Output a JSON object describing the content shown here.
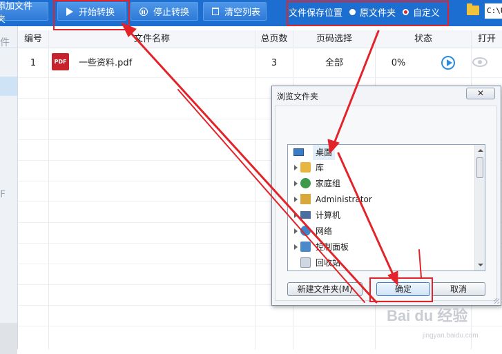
{
  "toolbar": {
    "add_files_label": "添加文件夹",
    "start_label": "开始转换",
    "stop_label": "停止转换",
    "clear_label": "清空列表",
    "save_location_label": "文件保存位置",
    "option_original": "原文件夹",
    "option_custom": "自定义",
    "selected_option": "custom",
    "path_value": "C:\\U"
  },
  "left_strip": {
    "label_a": "件",
    "label_b": "F"
  },
  "table": {
    "headers": [
      "编号",
      "文件名称",
      "总页数",
      "页码选择",
      "状态",
      "打开"
    ],
    "rows": [
      {
        "index": "1",
        "filename": "一些资料.pdf",
        "pages": "3",
        "page_select": "全部",
        "status": "0%",
        "file_icon": "PDF"
      }
    ]
  },
  "dialog": {
    "title": "浏览文件夹",
    "close_label": "✕",
    "tree": [
      {
        "label": "桌面",
        "icon": "desktop-icon",
        "selected": true
      },
      {
        "label": "库",
        "icon": "library-icon"
      },
      {
        "label": "家庭组",
        "icon": "homegroup-icon"
      },
      {
        "label": "Administrator",
        "icon": "user-folder-icon"
      },
      {
        "label": "计算机",
        "icon": "computer-icon"
      },
      {
        "label": "网络",
        "icon": "network-icon"
      },
      {
        "label": "控制面板",
        "icon": "control-panel-icon"
      },
      {
        "label": "回收站",
        "icon": "recycle-bin-icon"
      }
    ],
    "new_folder_label": "新建文件夹(M)",
    "ok_label": "确定",
    "cancel_label": "取消"
  },
  "watermark": {
    "text": "Bai du 经验",
    "url": "jingyan.baidu.com"
  },
  "colors": {
    "toolbar_bg": "#1c6fd1",
    "annotation_red": "#e3232a",
    "pdf_red": "#c8232c",
    "play_blue": "#2b8de0"
  }
}
